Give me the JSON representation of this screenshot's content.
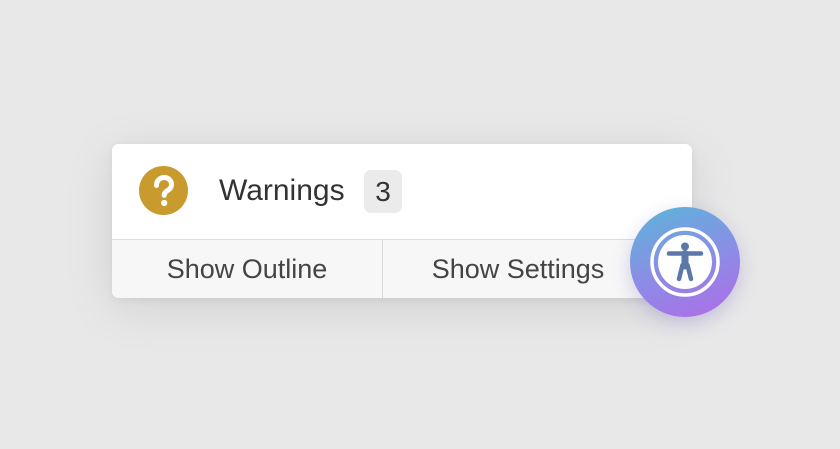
{
  "warnings_panel": {
    "icon": "question-circle-icon",
    "icon_color": "#c99a2e",
    "title": "Warnings",
    "count": "3"
  },
  "actions": {
    "show_outline_label": "Show Outline",
    "show_settings_label": "Show Settings"
  },
  "accessibility_button": {
    "icon": "accessibility-person-icon",
    "gradient_start": "#5ab6d9",
    "gradient_end": "#b06be6"
  }
}
